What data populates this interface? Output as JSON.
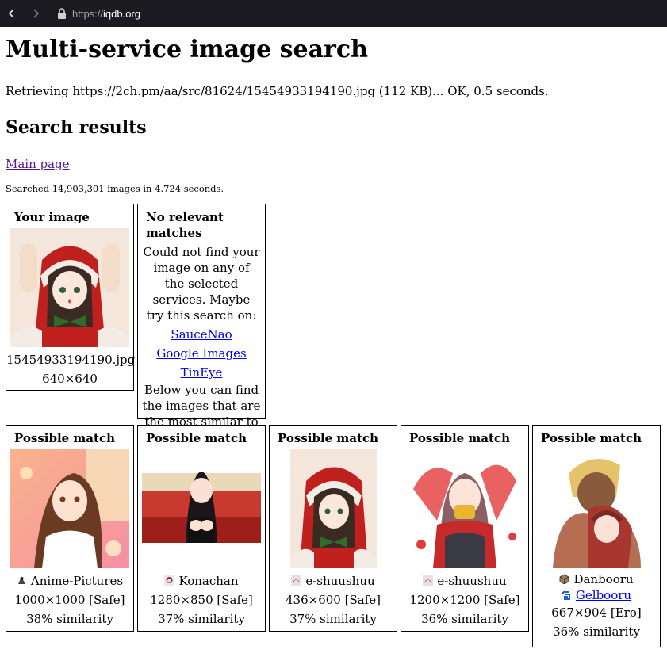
{
  "browser": {
    "url_prefix": "https://",
    "url_host": "iqdb.org"
  },
  "page": {
    "title": "Multi-service image search",
    "retrieving": "Retrieving https://2ch.pm/aa/src/81624/15454933194190.jpg (112 KB)... OK, 0.5 seconds.",
    "results_heading": "Search results",
    "main_page_link": "Main page",
    "stats": "Searched 14,903,301 images in 4.724 seconds."
  },
  "your_image": {
    "header": "Your image",
    "filename": "15454933194190.jpg",
    "dimensions": "640×640"
  },
  "no_matches": {
    "header": "No relevant matches",
    "text1": "Could not find your image on any of the selected services. Maybe try this search on:",
    "links": [
      "SauceNao",
      "Google Images",
      "TinEye"
    ],
    "text2": "Below you can find the images that are the most similar to yours."
  },
  "matches": [
    {
      "header": "Possible match",
      "service": "Anime-Pictures",
      "icon": "anime-pictures-icon",
      "size": "1000×1000 [Safe]",
      "similarity": "38% similarity"
    },
    {
      "header": "Possible match",
      "service": "Konachan",
      "icon": "konachan-icon",
      "size": "1280×850 [Safe]",
      "similarity": "37% similarity"
    },
    {
      "header": "Possible match",
      "service": "e-shuushuu",
      "icon": "e-shuushuu-icon",
      "size": "436×600 [Safe]",
      "similarity": "37% similarity"
    },
    {
      "header": "Possible match",
      "service": "e-shuushuu",
      "icon": "e-shuushuu-icon",
      "size": "1200×1200 [Safe]",
      "similarity": "36% similarity"
    },
    {
      "header": "Possible match",
      "service": "Danbooru",
      "icon": "danbooru-icon",
      "service2": "Gelbooru",
      "icon2": "gelbooru-icon",
      "size": "667×904 [Ero]",
      "similarity": "36% similarity"
    }
  ],
  "colors": {
    "topbar": "#1c1b22",
    "visited_link": "#551a8b",
    "link": "#0000ee"
  }
}
